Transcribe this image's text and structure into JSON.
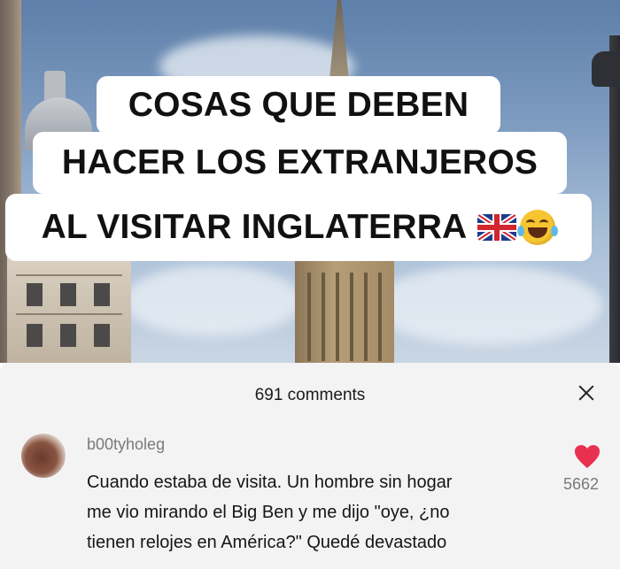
{
  "caption": {
    "line1": "COSAS QUE DEBEN",
    "line2": "HACER LOS EXTRANJEROS",
    "line3": "AL VISITAR INGLATERRA",
    "emojis": [
      "uk-flag",
      "tears-of-joy"
    ]
  },
  "comments_panel": {
    "title": "691 comments",
    "close_icon": "close-icon"
  },
  "comment": {
    "username": "b00tyholeg",
    "text_line1": "Cuando estaba de visita. Un hombre sin hogar",
    "text_line2": "me vio mirando el Big Ben y me dijo \"oye, ¿no",
    "text_line3": "tienen relojes en América?\" Quedé devastado",
    "likes": "5662",
    "like_icon": "heart-icon",
    "heart_color": "#e8304f"
  }
}
